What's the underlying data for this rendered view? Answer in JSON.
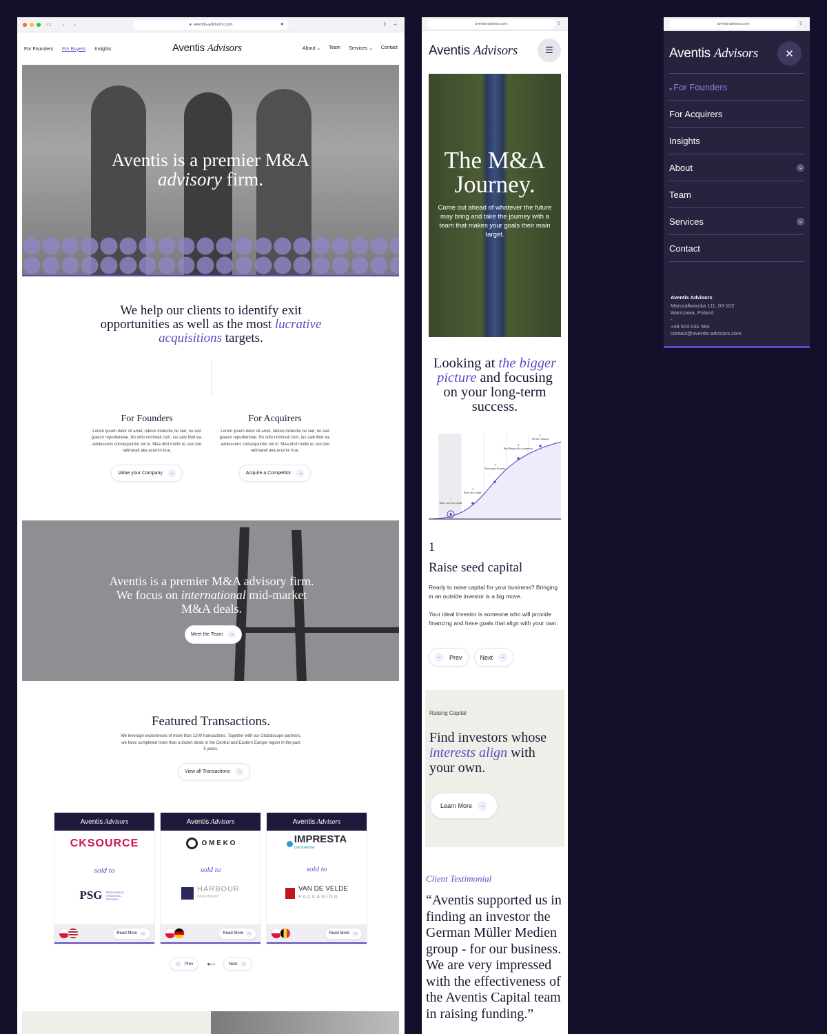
{
  "desktop": {
    "url": "aventis-advisors.com",
    "nav_left": [
      "For Founders",
      "For Buyers",
      "Insights"
    ],
    "logo_a": "Aventis",
    "logo_b": "Advisors",
    "nav_right": [
      "About",
      "Team",
      "Services",
      "Contact"
    ],
    "hero_line1": "Aventis is a premier M&A",
    "hero_em": "advisory",
    "hero_rest": " firm.",
    "help_a": "We help our clients to identify exit opportunities as well as the most ",
    "help_em": "lucrative acquisitions",
    "help_b": " targets.",
    "col1_title": "For Founders",
    "col2_title": "For Acquirers",
    "lorem": "Lorem ipsum dolor sit amet, labore molestie ne sed, no sed graeco repudiandae. No odio nominati cum, ius sale illud ea, adolescens consequuntur vel in. Mea dicit mollis ei, eos bre ratimarak aka acumin true.",
    "col1_btn": "Value your Company",
    "col2_btn": "Acquire a Competitor",
    "bridge_a": "Aventis is a premier M&A advisory firm. We focus on ",
    "bridge_em": "international",
    "bridge_b": " mid-market M&A deals.",
    "bridge_btn": "Meet the Team",
    "ft_title": "Featured Transactions.",
    "ft_text": "We leverage experiences of more than 1200 transactions. Together with our Globalscope partners, we have completed more than a dozen deals in the Central and Eastern Europe region in the past 5 years.",
    "ft_btn": "View all Transactions",
    "sold_to": "sold to",
    "read_more": "Read More",
    "cards": [
      {
        "seller": "CKSOURCE",
        "buyer": "PSG",
        "buyer_sub": "PROVIDENCE STRATEGIC GROWTH"
      },
      {
        "seller": "O M E K O",
        "buyer": "HARBOUR",
        "buyer_sub": "INVESTMENT"
      },
      {
        "seller": "IMPRESTA",
        "seller_sub": "DRUKARNIA",
        "buyer": "VAN DE VELDE",
        "buyer_sub": "PACKAGING"
      }
    ],
    "prev": "Prev",
    "next": "Next"
  },
  "mobile": {
    "url": "aventis-advisors.com",
    "hero_title": "The M&A Journey.",
    "hero_text": "Come out ahead of whatever the future may bring and take the journey with a team that makes your goals their main target.",
    "look_a": "Looking at ",
    "look_em": "the bigger picture",
    "look_b": " and focusing on your long-term success.",
    "steps": [
      "Raise your first capital",
      "Raise next rounds",
      "Attract growth equity",
      "Buy/Merge with a competitor",
      "Sell the company"
    ],
    "step_num": "1",
    "step_title": "Raise seed capital",
    "step_p1": "Ready to raise capital for your business? Bringing in an outside investor is a big move.",
    "step_p2": "Your ideal investor is someone who will provide financing and have goals that align with your own.",
    "prev": "Prev",
    "next": "Next",
    "rc_label": "Raising Capital",
    "rc_a": "Find investors whose ",
    "rc_em": "interests align",
    "rc_b": " with your own.",
    "rc_btn": "Learn More",
    "test_label": "Client Testimonial",
    "quote": "“Aventis supported us in finding an investor the German Müller Medien group - for our business. We are very impressed with the effectiveness of the Aventis Capital team in raising funding.”"
  },
  "menu": {
    "url": "aventis-advisors.com",
    "items": [
      "For Founders",
      "For Acquirers",
      "Insights",
      "About",
      "Team",
      "Services",
      "Contact"
    ],
    "company": "Aventis Advisors",
    "addr1": "Marszałkowska 111, 00-102",
    "addr2": "Warszawa, Poland",
    "dash": "-",
    "phone": "+48 504 031 584",
    "email": "contact@aventis-advisors.com"
  },
  "colors": {
    "accent": "#5b4bc4",
    "navy": "#1e1a3b",
    "bg": "#140f2b"
  }
}
